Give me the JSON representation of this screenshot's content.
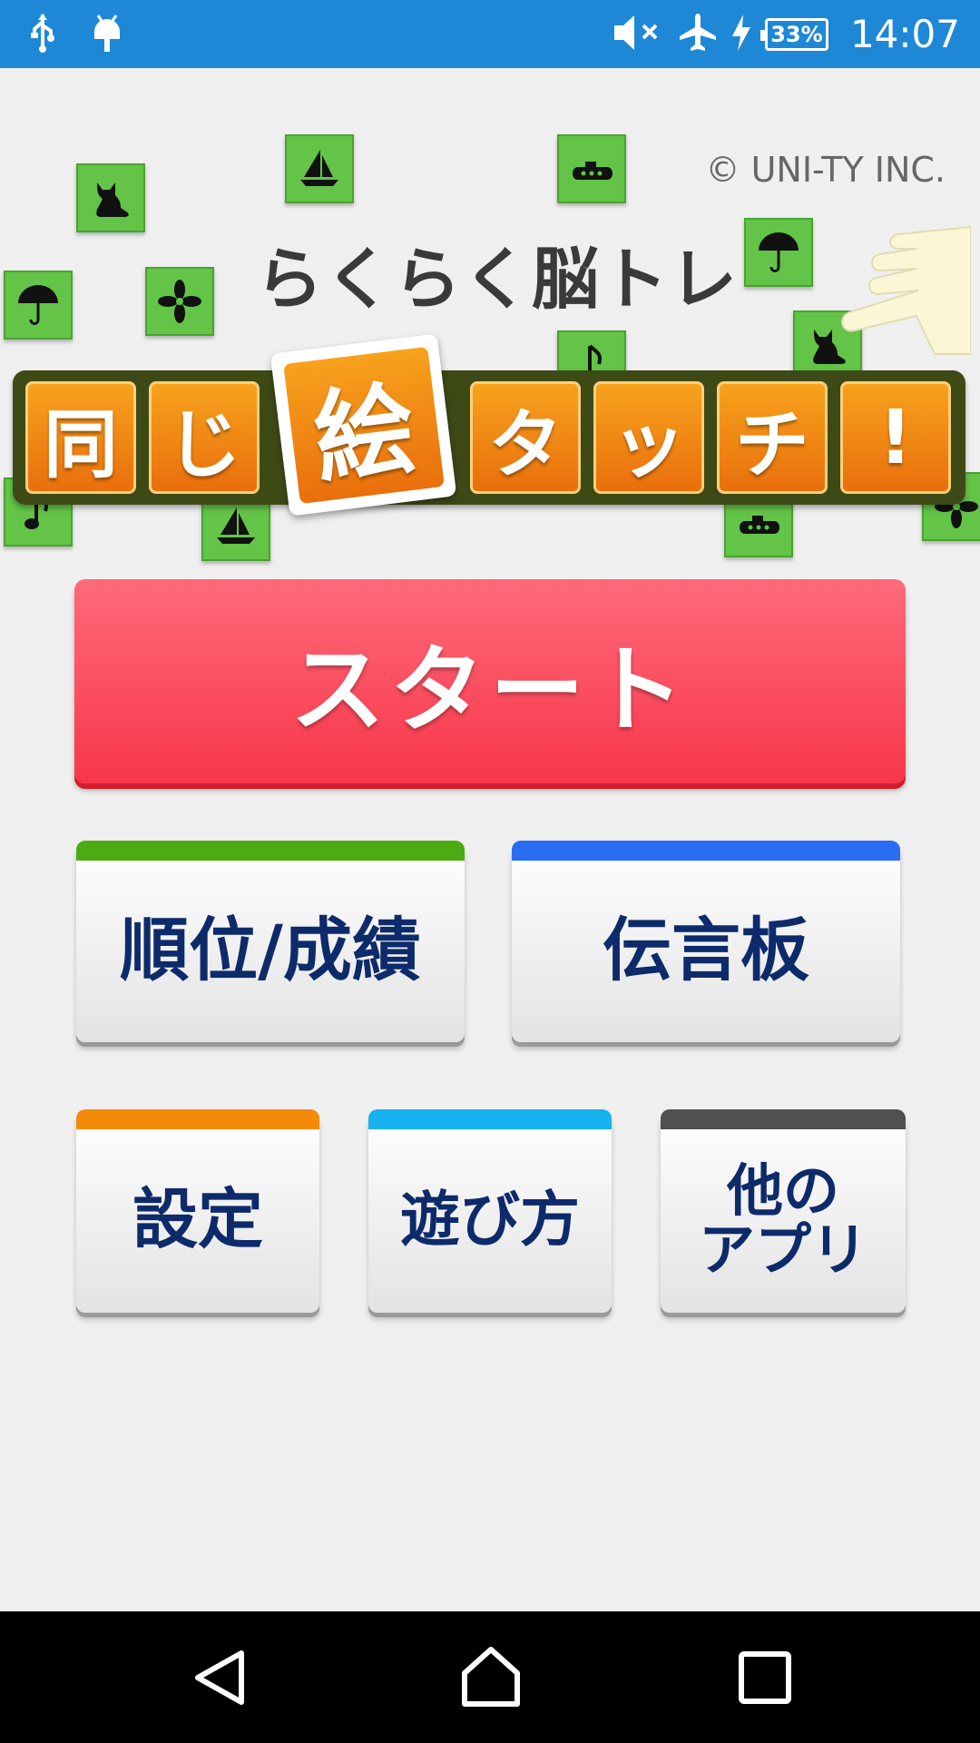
{
  "status_bar": {
    "time": "14:07",
    "battery": "33%",
    "icons": [
      "usb-icon",
      "android-debug-icon",
      "mute-icon",
      "airplane-mode-icon",
      "charging-icon",
      "battery-icon"
    ]
  },
  "header": {
    "copyright": "© UNI-TY INC.",
    "subtitle": "らくらく脳トレ",
    "logo_chars": [
      "同",
      "じ",
      "絵",
      "タ",
      "ッ",
      "チ",
      "!"
    ]
  },
  "buttons": {
    "start": "スタート",
    "ranking": "順位/成績",
    "board": "伝言板",
    "settings": "設定",
    "howto": "遊び方",
    "other_apps": "他の\nアプリ"
  },
  "colors": {
    "status_bar": "#1e88d6",
    "start": "#f7364a",
    "ranking_stripe": "#4caa12",
    "board_stripe": "#2a6cf2",
    "settings_stripe": "#f58a0a",
    "howto_stripe": "#16b1ee",
    "other_stripe": "#505050",
    "tile": "#63c447",
    "label_text": "#0d2b6b"
  }
}
